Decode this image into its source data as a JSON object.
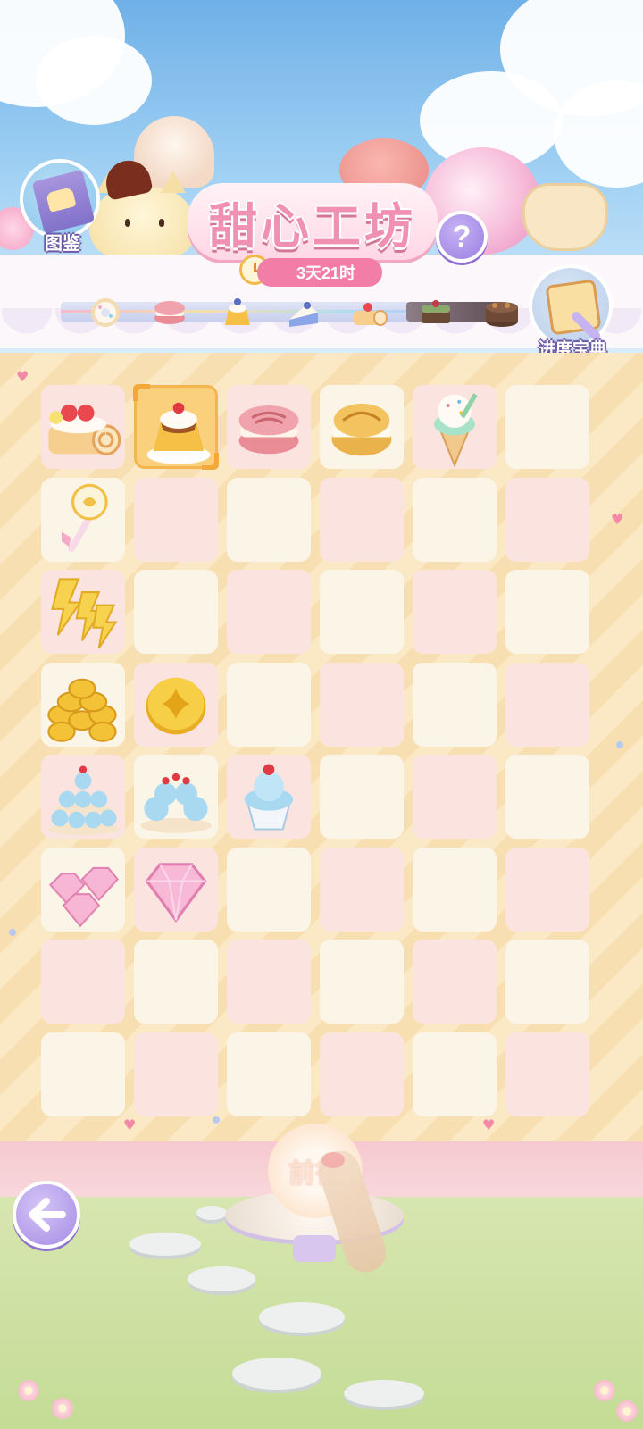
{
  "header": {
    "title": "甜心工坊",
    "timer": "3天21时",
    "help_symbol": "?",
    "book_label": "图鉴",
    "guide_label": "进度宝典"
  },
  "progress_track": [
    "donut-icon",
    "macaron-icon",
    "pudding-icon",
    "cake-slice-icon",
    "roll-cake-icon",
    "brownie-icon",
    "chocolate-cake-icon"
  ],
  "board": {
    "rows": 8,
    "cols": 6,
    "cells": [
      [
        "roll-cake-icon",
        "pudding-icon",
        "macaron-icon",
        "cream-puff-icon",
        "ice-cream-icon",
        ""
      ],
      [
        "wand-icon",
        "",
        "",
        "",
        "",
        ""
      ],
      [
        "energy-bolts-icon",
        "",
        "",
        "",
        "",
        ""
      ],
      [
        "coin-pile-icon",
        "coin-icon",
        "",
        "",
        "",
        ""
      ],
      [
        "cupcake-tower-icon",
        "cupcake-plate-icon",
        "cupcake-icon",
        "",
        "",
        ""
      ],
      [
        "gem-pile-icon",
        "gem-icon",
        "",
        "",
        "",
        ""
      ],
      [
        "",
        "",
        "",
        "",
        "",
        ""
      ],
      [
        "",
        "",
        "",
        "",
        "",
        ""
      ]
    ],
    "selected": [
      0,
      1
    ]
  },
  "footer": {
    "go_label": "前往",
    "back_icon": "back-arrow-icon"
  },
  "colors": {
    "accent_pink": "#f27ea7",
    "title_pink": "#f091b4",
    "purple_button": "#a68ce5",
    "cell_pink": "#fbe3e0",
    "cell_cream": "#fbf5e8",
    "selected_cell": "#fbd07d"
  }
}
